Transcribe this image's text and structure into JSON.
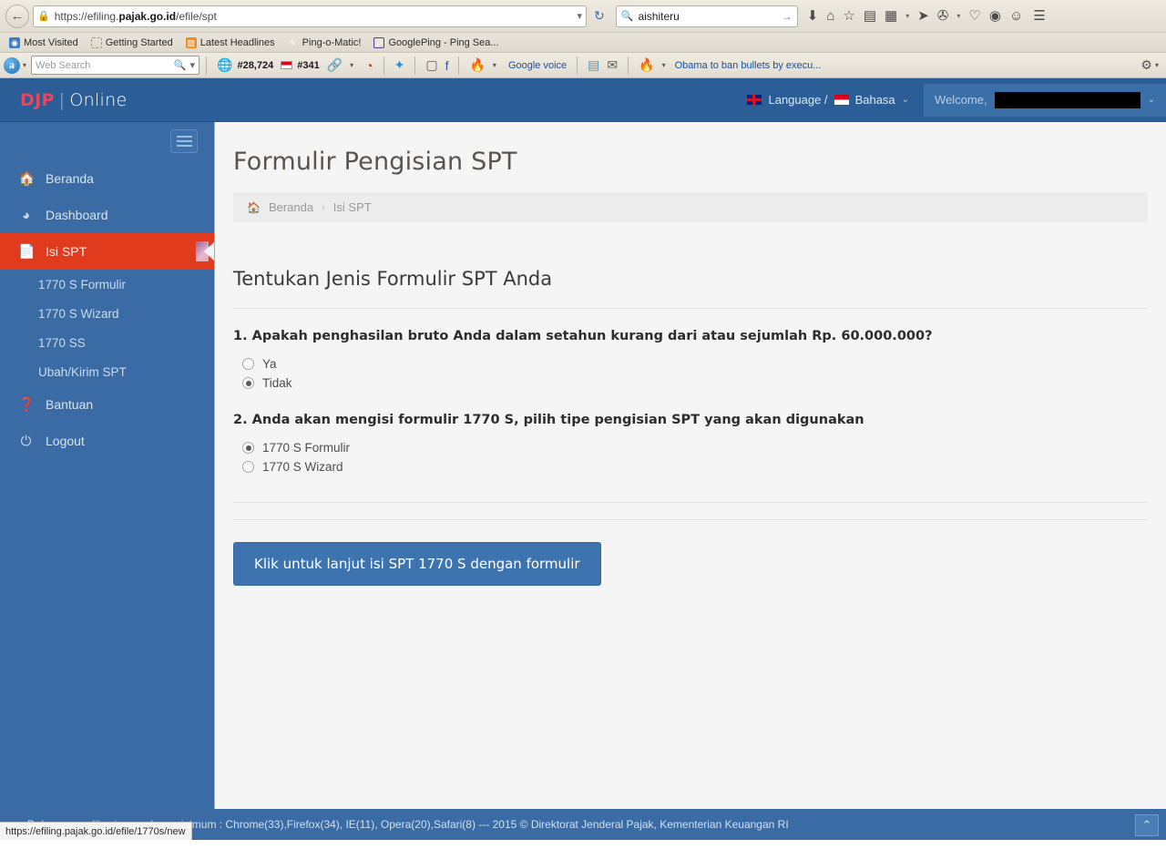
{
  "browser": {
    "back_label": "←",
    "lock_icon": "padlock-icon",
    "url_prefix": "https://efiling.",
    "url_domain": "pajak.go.id",
    "url_suffix": "/efile/spt",
    "url_dropdown": "▾",
    "reload_icon": "↻",
    "search_value": "aishiteru",
    "search_go": "→",
    "toolbar_icons": [
      "download-icon",
      "home-icon",
      "bookmark-star-icon",
      "reading-list-icon",
      "s3-icon",
      "caret-down-icon",
      "paper-plane-icon",
      "bug-icon",
      "caret-down-icon",
      "heart-icon",
      "play-circle-icon",
      "smiley-icon",
      "hamburger-menu-icon"
    ],
    "bookmarks": [
      {
        "label": "Most Visited",
        "icon": "globe-icon"
      },
      {
        "label": "Getting Started",
        "icon": "dashed-box-icon"
      },
      {
        "label": "Latest Headlines",
        "icon": "rss-icon"
      },
      {
        "label": "Ping-o-Matic!",
        "icon": "pin-icon"
      },
      {
        "label": "GooglePing - Ping Sea...",
        "icon": "p-circle-icon"
      }
    ],
    "alexa": {
      "logo_letter": "a",
      "web_search_placeholder": "Web Search",
      "global_rank": "#28,724",
      "country_rank": "#341",
      "google_voice_label": "Google voice",
      "news_headline": "Obama to ban bullets by execu..."
    },
    "status_url": "https://efiling.pajak.go.id/efile/1770s/new"
  },
  "header": {
    "brand_djp": "DJP",
    "brand_pipe": "|",
    "brand_online": "Online",
    "language_label": "Language /",
    "bahasa_label": "Bahasa",
    "welcome_label": "Welcome,",
    "welcome_name": ""
  },
  "sidebar": {
    "items": [
      {
        "label": "Beranda",
        "icon": "home-icon",
        "active": false
      },
      {
        "label": "Dashboard",
        "icon": "dashboard-icon",
        "active": false
      },
      {
        "label": "Isi SPT",
        "icon": "file-icon",
        "active": true
      }
    ],
    "sub_items": [
      {
        "label": "1770 S Formulir"
      },
      {
        "label": "1770 S Wizard"
      },
      {
        "label": "1770 SS"
      },
      {
        "label": "Ubah/Kirim SPT"
      }
    ],
    "bottom_items": [
      {
        "label": "Bantuan",
        "icon": "question-circle-icon"
      },
      {
        "label": "Logout",
        "icon": "power-icon"
      }
    ]
  },
  "main": {
    "page_title": "Formulir Pengisian SPT",
    "breadcrumb": {
      "home": "Beranda",
      "separator": "›",
      "current": "Isi SPT"
    },
    "section_title": "Tentukan Jenis Formulir SPT Anda",
    "questions": [
      {
        "text": "1. Apakah penghasilan bruto Anda dalam setahun kurang dari atau sejumlah Rp. 60.000.000?",
        "options": [
          {
            "label": "Ya",
            "selected": false
          },
          {
            "label": "Tidak",
            "selected": true
          }
        ]
      },
      {
        "text": "2. Anda akan mengisi formulir 1770 S, pilih tipe pengisian SPT yang akan digunakan",
        "options": [
          {
            "label": "1770 S Formulir",
            "selected": true
          },
          {
            "label": "1770 S Wizard",
            "selected": false
          }
        ]
      }
    ],
    "submit_label": "Klik untuk lanjut isi SPT 1770 S dengan formulir"
  },
  "footer": {
    "text": "Dukungan aplikasi peramban minimum : Chrome(33),Firefox(34), IE(11), Opera(20),Safari(8) --- 2015 © Direktorat Jenderal Pajak, Kementerian Keuangan RI",
    "scroll_top_icon": "chevron-up-icon"
  },
  "colors": {
    "brand_blue": "#2b5d96",
    "sidebar_blue": "#3b6ba5",
    "active_red": "#e03b1c",
    "button_blue": "#3d74b0",
    "accent_pink": "#e8455f"
  }
}
